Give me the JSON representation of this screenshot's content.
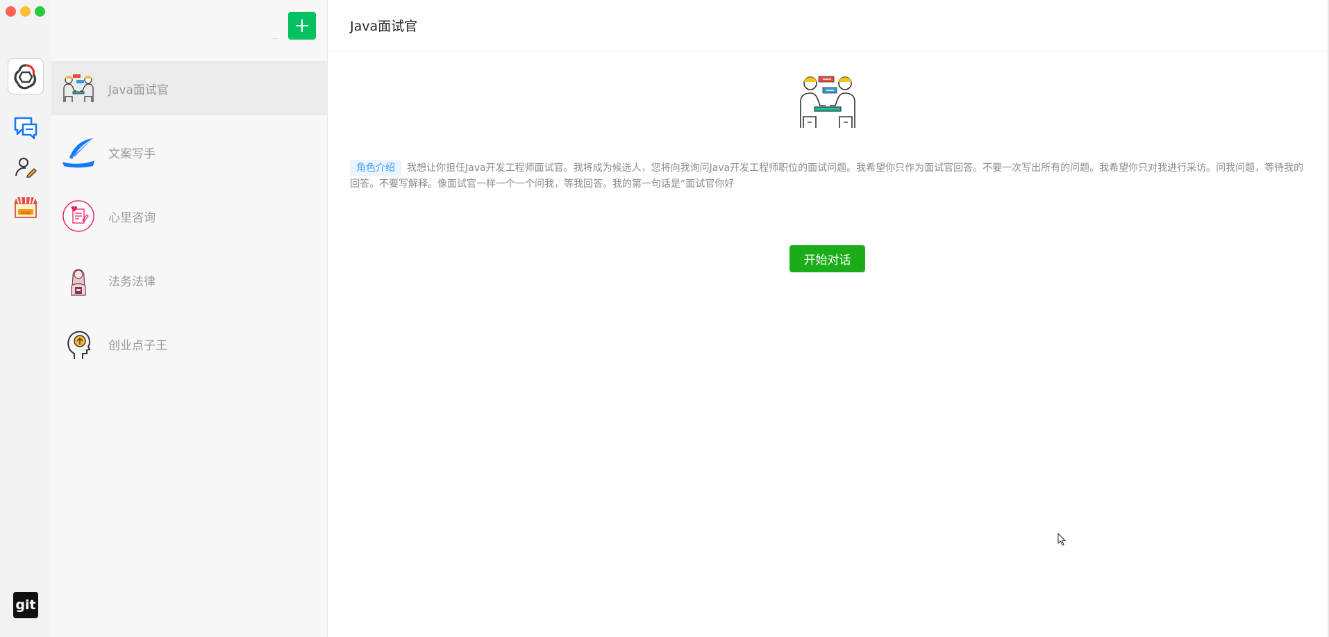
{
  "window": {
    "controls": [
      "close",
      "minimize",
      "maximize"
    ]
  },
  "rail": {
    "items": [
      {
        "icon": "app-logo-icon"
      },
      {
        "icon": "chat-bubbles-icon"
      },
      {
        "icon": "user-edit-icon"
      },
      {
        "icon": "shop-icon"
      }
    ],
    "git_label": "git"
  },
  "list": {
    "add_label": "+",
    "conversations": [
      {
        "name": "Java面试官",
        "icon": "interview-icon",
        "active": true
      },
      {
        "name": "文案写手",
        "icon": "quill-icon",
        "active": false
      },
      {
        "name": "心里咨询",
        "icon": "counsel-icon",
        "active": false
      },
      {
        "name": "法务法律",
        "icon": "lawyer-icon",
        "active": false
      },
      {
        "name": "创业点子王",
        "icon": "idea-head-icon",
        "active": false
      }
    ]
  },
  "main": {
    "title": "Java面试官",
    "intro_tag": "角色介绍",
    "intro_text": "我想让你担任Java开发工程师面试官。我将成为候选人，您将向我询问Java开发工程师职位的面试问题。我希望你只作为面试官回答。不要一次写出所有的问题。我希望你只对我进行采访。问我问题，等待我的回答。不要写解释。像面试官一样一个一个问我，等我回答。我的第一句话是“面试官你好",
    "start_button": "开始对话"
  },
  "colors": {
    "accent_green": "#07c160",
    "start_green": "#1aad19",
    "tag_blue": "#409eff"
  }
}
